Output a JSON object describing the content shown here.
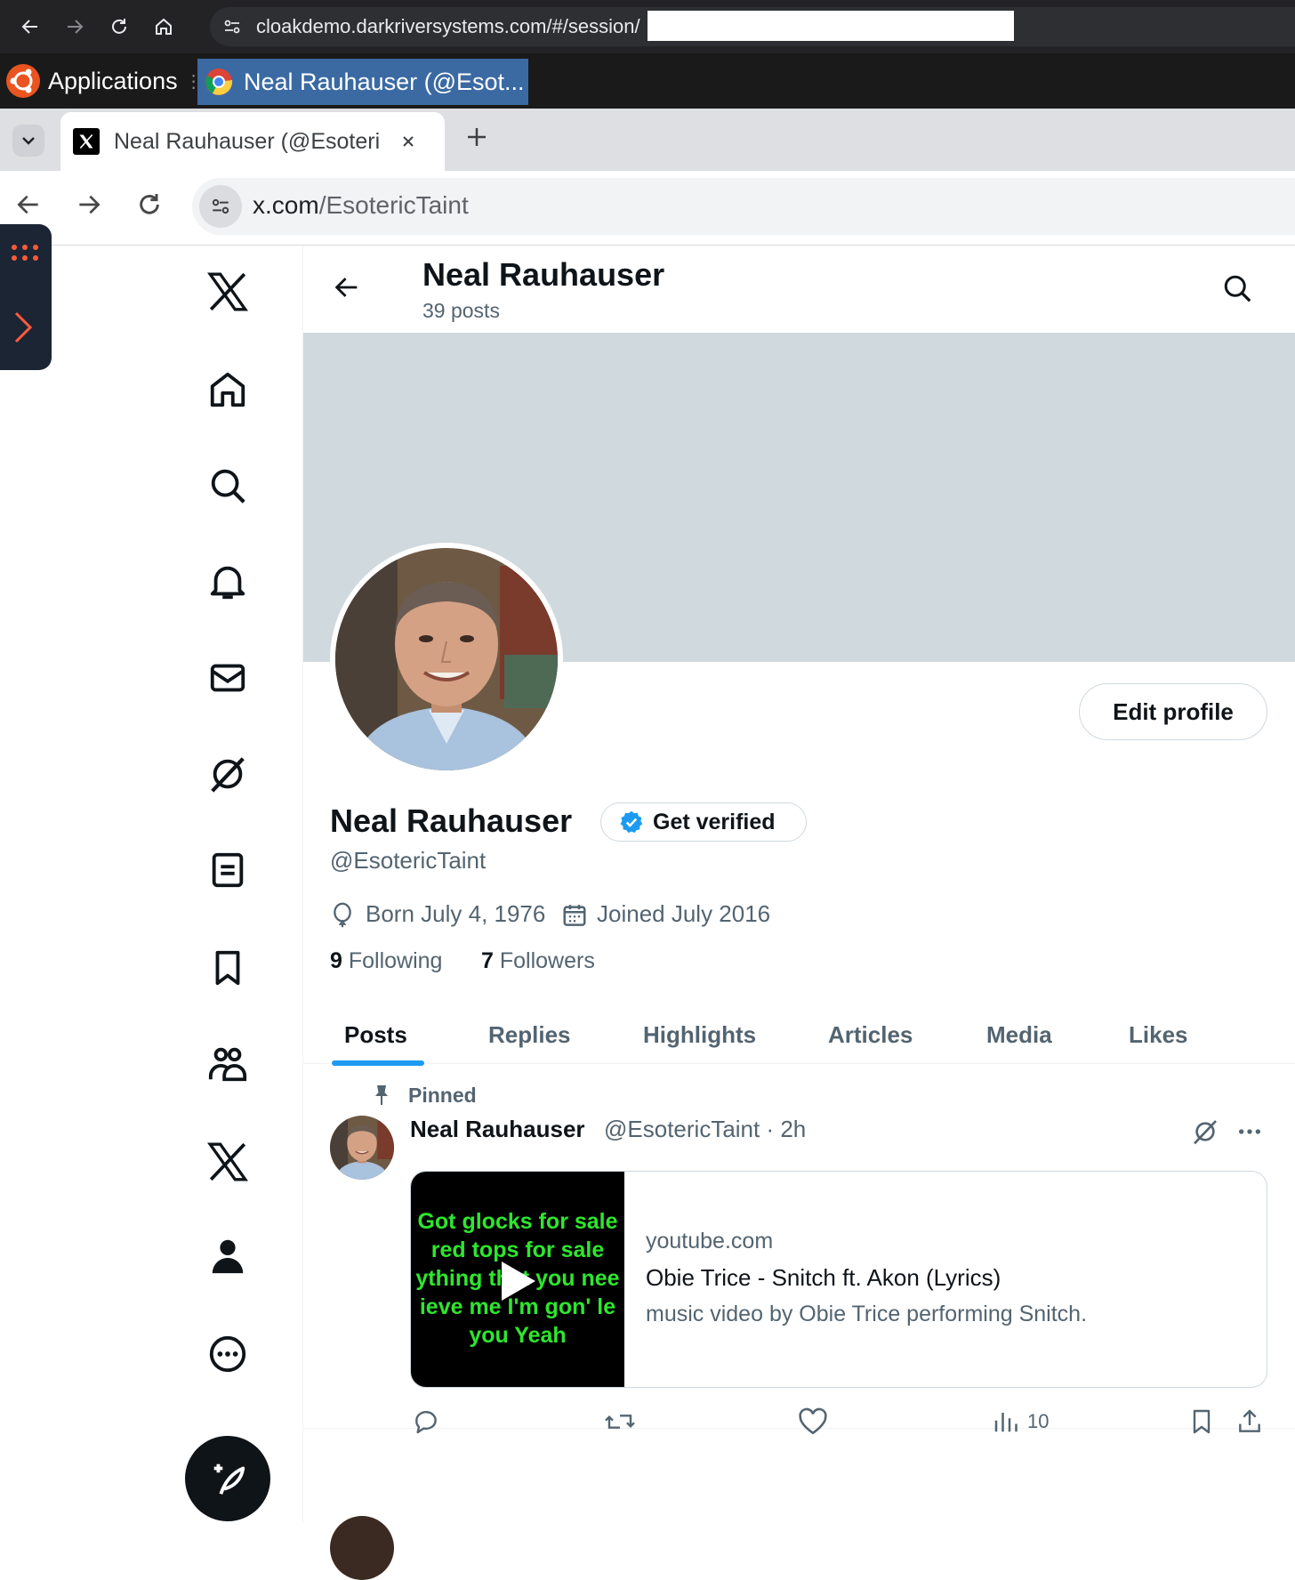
{
  "outer_browser": {
    "url": "cloakdemo.darkriversystems.com/#/session/"
  },
  "taskbar": {
    "applications_label": "Applications",
    "active_window_title": "Neal Rauhauser (@Esot..."
  },
  "tab": {
    "title": "Neal Rauhauser (@EsotericTaint) / X"
  },
  "addressbar": {
    "host": "x.com",
    "path": "/EsotericTaint"
  },
  "header": {
    "name": "Neal Rauhauser",
    "posts": "39 posts"
  },
  "profile": {
    "name": "Neal Rauhauser",
    "get_verified": "Get verified",
    "handle": "@EsotericTaint",
    "born": "Born July 4, 1976",
    "joined": "Joined July 2016",
    "following_count": "9",
    "following_label": "Following",
    "followers_count": "7",
    "followers_label": "Followers",
    "edit_profile": "Edit profile",
    "banner_color": "#cfd9de"
  },
  "tabs": [
    {
      "label": "Posts",
      "active": true
    },
    {
      "label": "Replies"
    },
    {
      "label": "Highlights"
    },
    {
      "label": "Articles"
    },
    {
      "label": "Media"
    },
    {
      "label": "Likes"
    }
  ],
  "post": {
    "pinned_label": "Pinned",
    "author": "Neal Rauhauser",
    "meta": "@EsotericTaint · 2h",
    "card": {
      "thumbnail_lines": [
        "Got glocks for sale",
        "red tops for sale",
        "ything that you nee",
        "ieve me I'm gon' le",
        "you Yeah"
      ],
      "domain": "youtube.com",
      "title": "Obie Trice - Snitch ft. Akon (Lyrics)",
      "description": "music video by Obie Trice performing Snitch."
    },
    "views": "10"
  },
  "colors": {
    "accent": "#1d9bf0",
    "text": "#0f1419",
    "secondary": "#536471"
  }
}
